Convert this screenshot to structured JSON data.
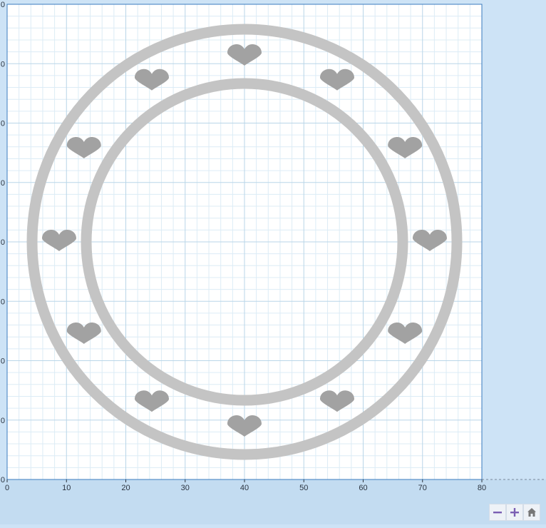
{
  "axes": {
    "x_ticks": [
      "0",
      "10",
      "20",
      "30",
      "40",
      "50",
      "60",
      "70",
      "80"
    ],
    "y_ticks": [
      "0",
      "0",
      "0",
      "0",
      "0",
      "0",
      "0",
      "0",
      "0"
    ]
  },
  "design": {
    "outer_ring_color": "#c4c4c4",
    "inner_ring_color": "#c4c4c4",
    "heart_color": "#a2a2a2",
    "heart_count": 12
  },
  "controls": {
    "zoom_out": "zoom-out-icon",
    "zoom_in": "zoom-in-icon",
    "home": "home-icon"
  },
  "colors": {
    "grid_minor": "#dcecf6",
    "grid_major": "#b9d6e8",
    "plot_border": "#3a7bbf",
    "background": "#cde3f6"
  }
}
